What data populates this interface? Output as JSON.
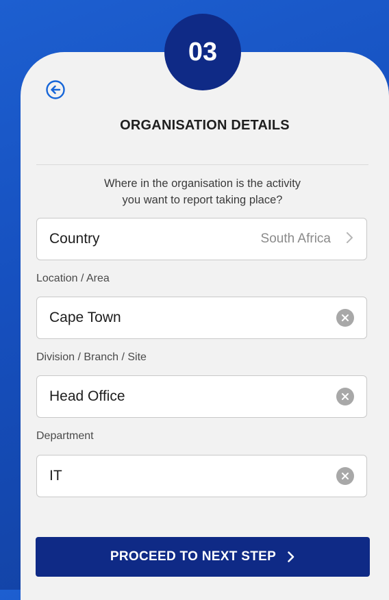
{
  "step": {
    "number": "03"
  },
  "header": {
    "title": "ORGANISATION DETAILS"
  },
  "question": {
    "line1": "Where in the organisation is the activity",
    "line2": "you want to report taking place?"
  },
  "country": {
    "label": "Country",
    "value": "South Africa"
  },
  "location": {
    "label": "Location / Area",
    "value": "Cape Town"
  },
  "division": {
    "label": "Division / Branch / Site",
    "value": "Head Office"
  },
  "department": {
    "label": "Department",
    "value": "IT"
  },
  "proceed": {
    "label": "PROCEED TO NEXT STEP"
  },
  "colors": {
    "brand": "#0f2a86",
    "background": "#1650bf",
    "card": "#f2f2f2"
  }
}
